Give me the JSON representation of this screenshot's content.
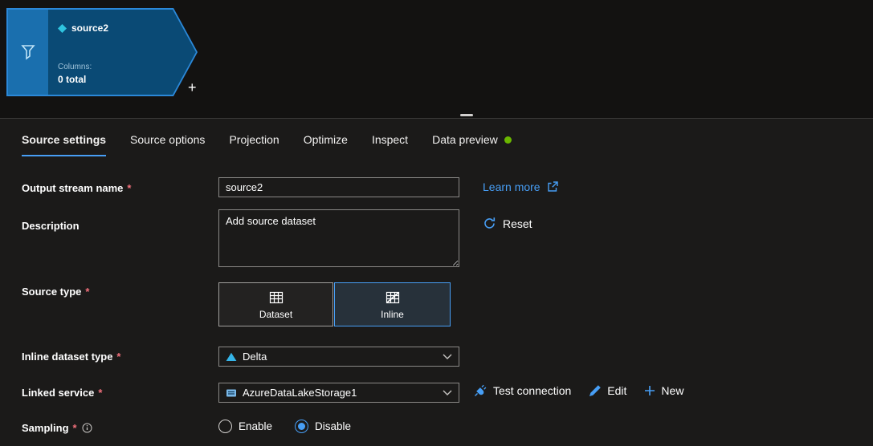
{
  "colors": {
    "accent": "#479ef5",
    "required": "#f1707b",
    "status_green": "#6bb700",
    "node_border": "#2b88d8",
    "node_fill": "#0a4a75"
  },
  "ui": {
    "required_marker": "*",
    "add_node_label": "+"
  },
  "canvas": {
    "node": {
      "name": "source2",
      "columns_label": "Columns:",
      "columns_value": "0 total"
    }
  },
  "tabs": [
    {
      "label": "Source settings",
      "active": true
    },
    {
      "label": "Source options"
    },
    {
      "label": "Projection"
    },
    {
      "label": "Optimize"
    },
    {
      "label": "Inspect"
    },
    {
      "label": "Data preview",
      "has_status_dot": true
    }
  ],
  "form": {
    "output_stream": {
      "label": "Output stream name",
      "value": "source2"
    },
    "learn_more_label": "Learn more",
    "description": {
      "label": "Description",
      "value": "Add source dataset"
    },
    "reset_label": "Reset",
    "source_type": {
      "label": "Source type",
      "options": [
        {
          "label": "Dataset",
          "selected": false
        },
        {
          "label": "Inline",
          "selected": true
        }
      ]
    },
    "inline_dataset_type": {
      "label": "Inline dataset type",
      "value": "Delta"
    },
    "linked_service": {
      "label": "Linked service",
      "value": "AzureDataLakeStorage1"
    },
    "actions": {
      "test_connection": "Test connection",
      "edit": "Edit",
      "new": "New"
    },
    "sampling": {
      "label": "Sampling",
      "options": [
        {
          "label": "Enable",
          "selected": false
        },
        {
          "label": "Disable",
          "selected": true
        }
      ]
    }
  }
}
